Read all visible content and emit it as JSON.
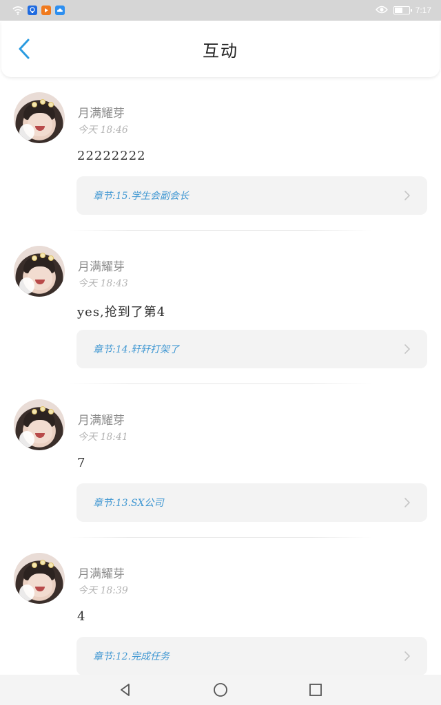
{
  "status_bar": {
    "time": "7:17",
    "icons": [
      "wifi-icon",
      "bulb-app-icon",
      "play-app-icon",
      "cloud-app-icon",
      "eye-icon",
      "battery-icon"
    ],
    "battery_level": 0.5
  },
  "header": {
    "title": "互动",
    "back_icon": "chevron-left-icon",
    "accent": "#2a9be0"
  },
  "comments": [
    {
      "username": "月满耀芽",
      "time": "今天 18:46",
      "text": "22222222",
      "chapter": "章节:15.学生会副会长"
    },
    {
      "username": "月满耀芽",
      "time": "今天 18:43",
      "text": "yes,抢到了第4",
      "chapter": "章节:14.轩轩打架了"
    },
    {
      "username": "月满耀芽",
      "time": "今天 18:41",
      "text": "7",
      "chapter": "章节:13.SX公司"
    },
    {
      "username": "月满耀芽",
      "time": "今天 18:39",
      "text": "4",
      "chapter": "章节:12.完成任务"
    }
  ],
  "colors": {
    "chapter_text": "#3f97d2",
    "status_bar_bg": "#d6d6d6"
  },
  "nav": {
    "icons": [
      "back-triangle-icon",
      "home-circle-icon",
      "recents-square-icon"
    ]
  }
}
